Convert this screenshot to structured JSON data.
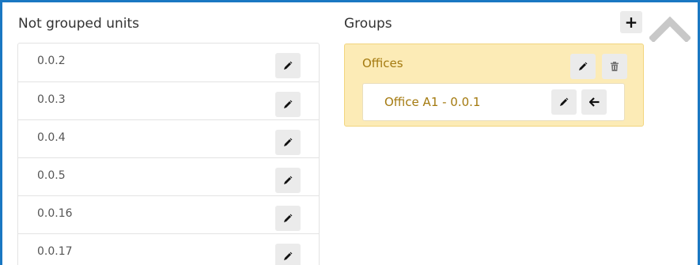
{
  "left_panel": {
    "title": "Not grouped units",
    "units": [
      {
        "label": "0.0.2"
      },
      {
        "label": "0.0.3"
      },
      {
        "label": "0.0.4"
      },
      {
        "label": "0.0.5"
      },
      {
        "label": "0.0.16"
      },
      {
        "label": "0.0.17"
      }
    ],
    "row_action_icon": "pencil-icon"
  },
  "right_panel": {
    "title": "Groups",
    "add_icon": "plus-icon",
    "add_label": "+",
    "scroll_icon": "chevron-up-icon",
    "groups": [
      {
        "name": "Offices",
        "actions": [
          "pencil-icon",
          "trash-icon"
        ],
        "units": [
          {
            "label": "Office A1 - 0.0.1",
            "actions": [
              "pencil-icon",
              "arrow-left-icon"
            ]
          }
        ]
      }
    ]
  },
  "colors": {
    "frame_border": "#1a78c2",
    "group_background": "#fcebb6",
    "group_border": "#f2d57e",
    "group_text": "#a47a10",
    "button_background": "#ebebeb"
  }
}
